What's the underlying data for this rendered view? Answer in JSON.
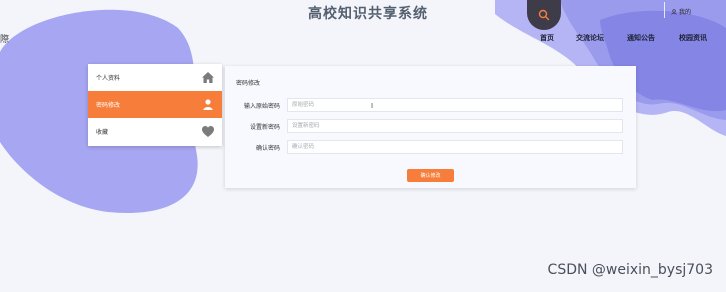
{
  "header": {
    "site_title": "高校知识共享系统",
    "brand_partial": "際",
    "user_label": "我的",
    "search_icon": "search-icon"
  },
  "nav": {
    "items": [
      "首页",
      "交流论坛",
      "通知公告",
      "校园资讯"
    ]
  },
  "sidebar": {
    "items": [
      {
        "label": "个人资料",
        "icon": "home-icon",
        "active": false
      },
      {
        "label": "密码修改",
        "icon": "user-icon",
        "active": true
      },
      {
        "label": "收藏",
        "icon": "heart-icon",
        "active": false
      }
    ]
  },
  "form": {
    "title": "密码修改",
    "fields": [
      {
        "label": "输入原始密码",
        "placeholder": "原始密码",
        "value": ""
      },
      {
        "label": "设置新密码",
        "placeholder": "设置新密码",
        "value": ""
      },
      {
        "label": "确认密码",
        "placeholder": "确认密码",
        "value": ""
      }
    ],
    "submit_label": "确认修改"
  },
  "watermark": "CSDN @weixin_bysj703",
  "colors": {
    "accent": "#f77e3a",
    "blob": "#a6a6f2",
    "blob_dark": "#8c8ceb",
    "search_bg": "#3f3c4a"
  }
}
